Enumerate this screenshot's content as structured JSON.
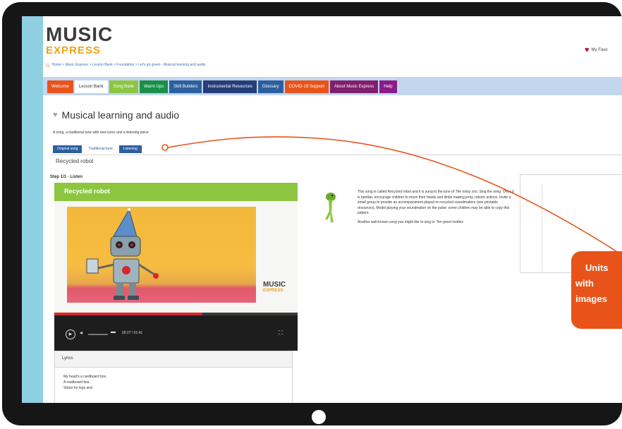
{
  "header": {
    "logo_music": "MUSIC",
    "logo_express": "EXPRESS",
    "favourites_label": "My Favo"
  },
  "breadcrumb": "Home > Music Express > Lesson Bank > Foundation > Let's go green - Musical learning and audio",
  "nav": {
    "tabs": [
      {
        "label": "Welcome",
        "color": "#e8531a"
      },
      {
        "label": "Lesson Bank",
        "color": "#ffffff"
      },
      {
        "label": "Song Bank",
        "color": "#8cc63f"
      },
      {
        "label": "Warm Ups",
        "color": "#1a8f4a"
      },
      {
        "label": "Skill Builders",
        "color": "#2d5f9e"
      },
      {
        "label": "Instrumental Resources",
        "color": "#253e7a"
      },
      {
        "label": "Glossary",
        "color": "#2d5f9e"
      },
      {
        "label": "COVID-19 Support",
        "color": "#e8531a"
      },
      {
        "label": "About Music Express",
        "color": "#7f1f6e"
      },
      {
        "label": "Help",
        "color": "#8a1c8a"
      }
    ]
  },
  "page": {
    "title": "Musical learning and audio",
    "intro": "A song, a traditional tune with new lyrics and a listening piece",
    "subtabs": [
      "Original song",
      "Traditional tune",
      "Listening"
    ],
    "section_label": "Recycled robot",
    "step_label": "Step 1/1 - Listen"
  },
  "video": {
    "title": "Recycled robot",
    "time": "00:27 / 01:41",
    "progress": 0.61
  },
  "lyrics": {
    "title": "Lyrics",
    "lines": [
      "My head's a cardboard box,",
      "A cardboard box,",
      "Sticks for legs and"
    ]
  },
  "description": {
    "para1": "This song is called Recycled robot and it is sung to the tune of The noisy zoo. Sing the song. Once it is familiar, encourage children to move their heads and limbs making jerky, robotic actions. Invite a small group to provide an accompaniment played on recycled soundmakers (see printable resources). Model playing your soundmaker on the pulse; some children may be able to copy this pattern.",
    "para2": "Another well-known song you might like to sing is: Ten green bottles"
  },
  "callout": {
    "lines": [
      "Units",
      "with",
      "images"
    ],
    "color": "#e8531a"
  }
}
